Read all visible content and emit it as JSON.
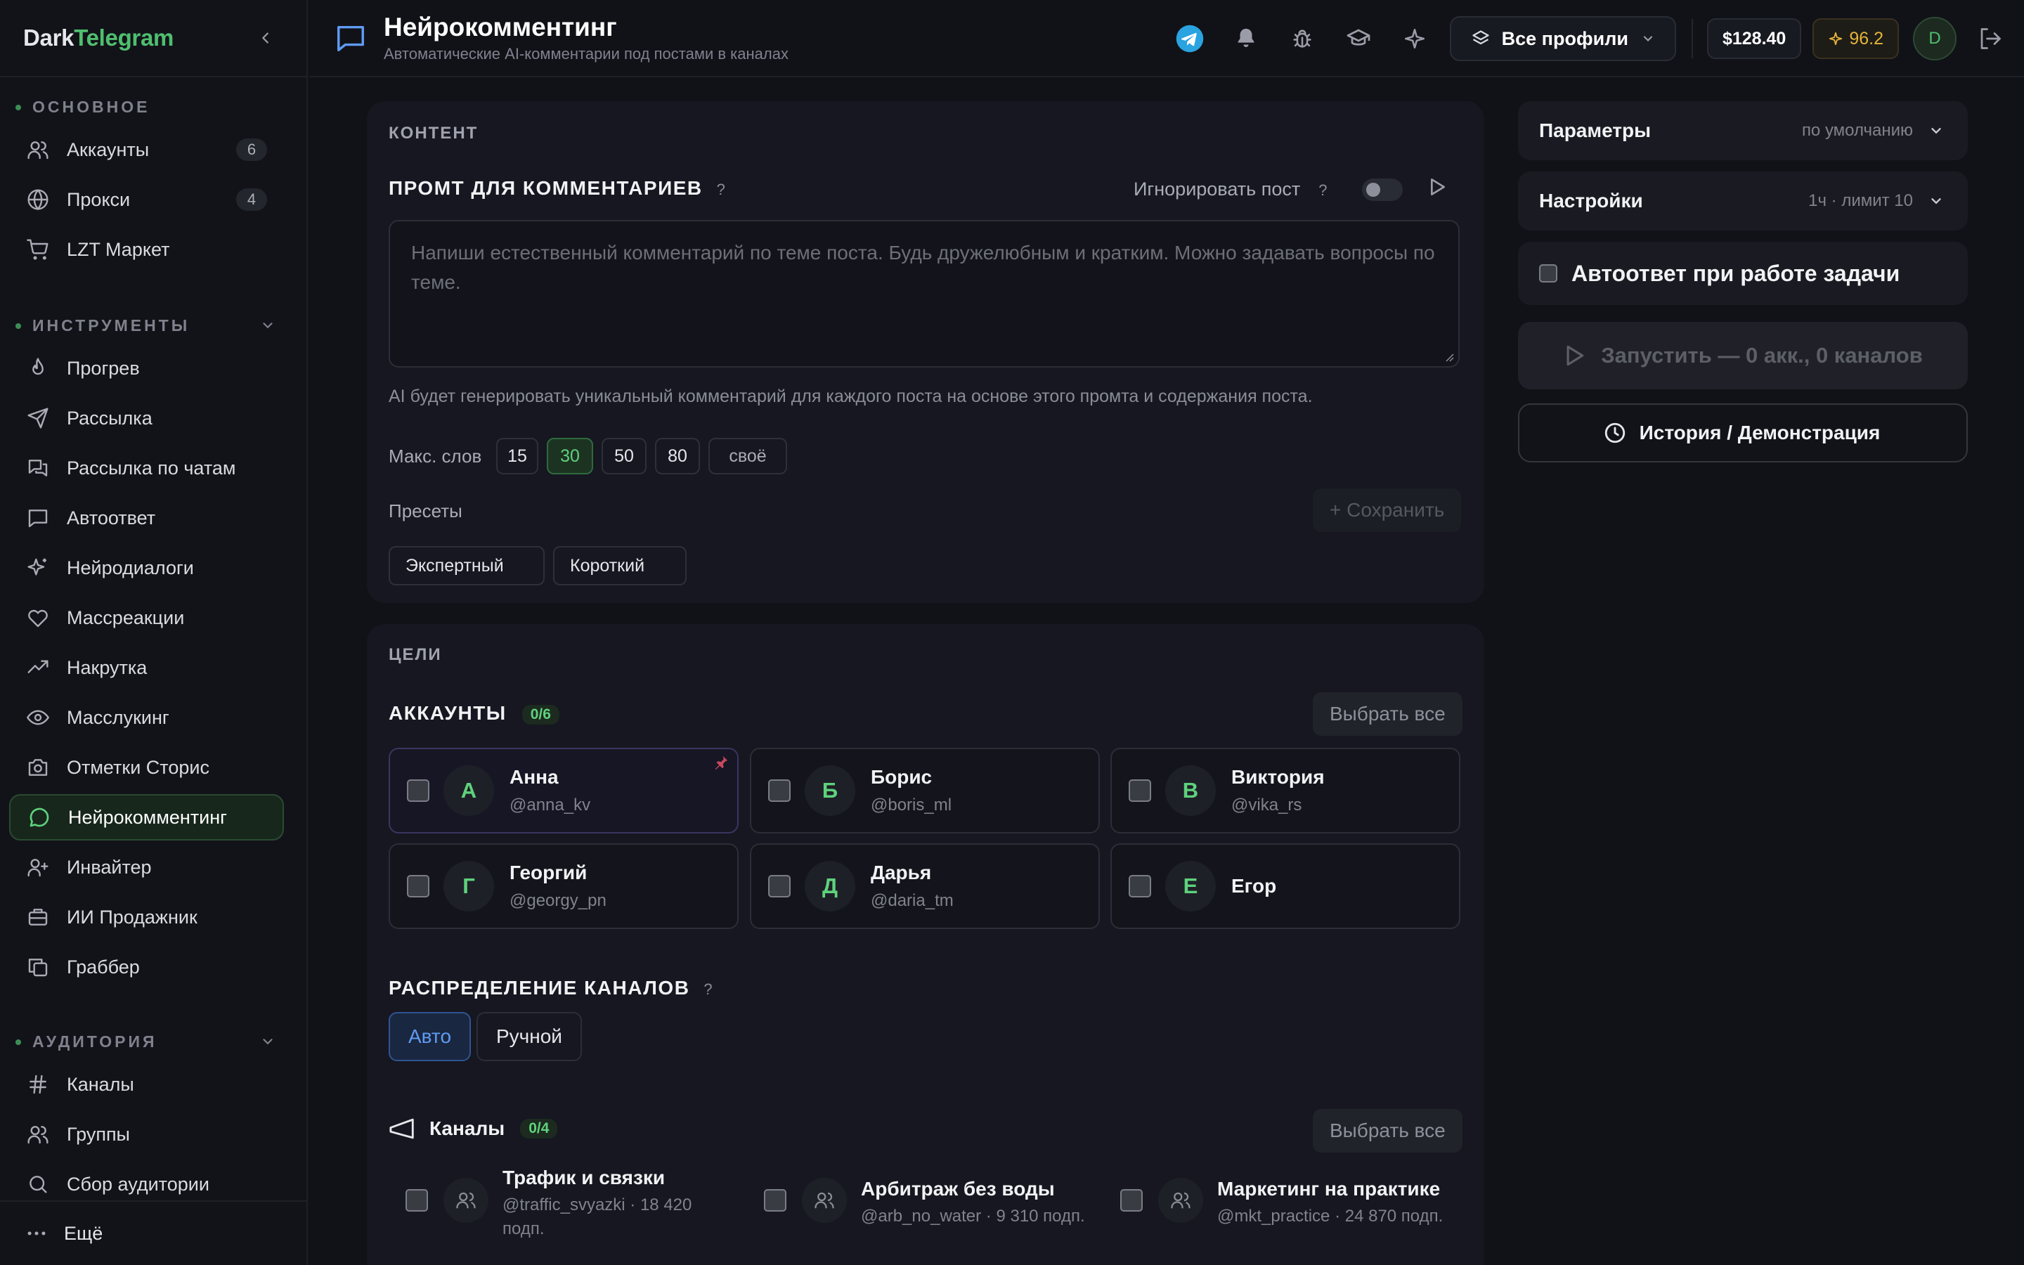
{
  "app": {
    "logo_prefix": "Dark",
    "logo_accent": "Telegram"
  },
  "sidebar": {
    "sections": [
      {
        "title": "ОСНОВНОЕ"
      },
      {
        "title": "ИНСТРУМЕНТЫ"
      },
      {
        "title": "АУДИТОРИЯ"
      }
    ],
    "main_items": [
      {
        "label": "Аккаунты",
        "badge": "6",
        "icon": "users-icon"
      },
      {
        "label": "Прокси",
        "badge": "4",
        "icon": "globe-icon"
      },
      {
        "label": "LZT Маркет",
        "icon": "cart-icon"
      }
    ],
    "tool_items": [
      {
        "label": "Прогрев",
        "icon": "flame-icon"
      },
      {
        "label": "Рассылка",
        "icon": "send-icon"
      },
      {
        "label": "Рассылка по чатам",
        "icon": "chats-icon"
      },
      {
        "label": "Автоответ",
        "icon": "message-square-icon"
      },
      {
        "label": "Нейродиалоги",
        "icon": "sparkles-icon"
      },
      {
        "label": "Массреакции",
        "icon": "heart-icon"
      },
      {
        "label": "Накрутка",
        "icon": "trending-up-icon"
      },
      {
        "label": "Масслукинг",
        "icon": "eye-icon"
      },
      {
        "label": "Отметки Сторис",
        "icon": "camera-icon"
      },
      {
        "label": "Нейрокомментинг",
        "icon": "message-circle-icon",
        "active": true
      },
      {
        "label": "Инвайтер",
        "icon": "user-plus-icon"
      },
      {
        "label": "ИИ Продажник",
        "icon": "briefcase-icon"
      },
      {
        "label": "Граббер",
        "icon": "copy-icon"
      }
    ],
    "audience_items": [
      {
        "label": "Каналы",
        "icon": "hash-icon"
      },
      {
        "label": "Группы",
        "icon": "users-icon"
      },
      {
        "label": "Сбор аудитории",
        "icon": "search-icon"
      }
    ],
    "more_label": "Ещё"
  },
  "header": {
    "title": "Нейрокомментинг",
    "subtitle": "Автоматические AI-комментарии под постами в каналах",
    "profile_select": "Все профили",
    "balance": "$128.40",
    "points": "96.2",
    "avatar_letter": "D"
  },
  "content_card": {
    "label": "КОНТЕНТ",
    "prompt_title": "ПРОМТ ДЛЯ КОММЕНТАРИЕВ",
    "help": "?",
    "ignore_post_label": "Игнорировать пост",
    "ignore_post_on": false,
    "prompt_placeholder": "Напиши естественный комментарий по теме поста. Будь дружелюбным и кратким. Можно задавать вопросы по теме.",
    "hint": "AI будет генерировать уникальный комментарий для каждого поста на основе этого промта и содержания поста.",
    "max_words_label": "Макс. слов",
    "max_words_options": [
      "15",
      "30",
      "50",
      "80",
      "своё"
    ],
    "max_words_selected": "30",
    "presets_label": "Пресеты",
    "save_label": "+ Сохранить",
    "presets": [
      "Экспертный",
      "Короткий"
    ]
  },
  "targets_card": {
    "label": "ЦЕЛИ",
    "accounts_title": "АККАУНТЫ",
    "accounts_count": "0/6",
    "select_all": "Выбрать все",
    "accounts": [
      {
        "letter": "А",
        "name": "Анна",
        "username": "@anna_kv",
        "pinned": true
      },
      {
        "letter": "Б",
        "name": "Борис",
        "username": "@boris_ml"
      },
      {
        "letter": "В",
        "name": "Виктория",
        "username": "@vika_rs"
      },
      {
        "letter": "Г",
        "name": "Георгий",
        "username": "@georgy_pn"
      },
      {
        "letter": "Д",
        "name": "Дарья",
        "username": "@daria_tm"
      },
      {
        "letter": "Е",
        "name": "Егор",
        "username": ""
      }
    ],
    "distribution_title": "РАСПРЕДЕЛЕНИЕ КАНАЛОВ",
    "distribution_options": [
      "Авто",
      "Ручной"
    ],
    "distribution_selected": "Авто",
    "channels_title": "Каналы",
    "channels_count": "0/4",
    "channels": [
      {
        "name": "Трафик и связки",
        "meta_line1": "@traffic_svyazki · 18 420",
        "meta_line2": "подп."
      },
      {
        "name": "Арбитраж без воды",
        "meta_line1": "@arb_no_water · 9 310 подп.",
        "meta_line2": ""
      },
      {
        "name": "Маркетинг на практике",
        "meta_line1": "@mkt_practice · 24 870 подп.",
        "meta_line2": ""
      }
    ]
  },
  "right_panel": {
    "params_title": "Параметры",
    "params_value": "по умолчанию",
    "settings_title": "Настройки",
    "settings_value": "1ч · лимит 10",
    "autoreply_label": "Автоответ при работе задачи",
    "run_label": "Запустить — 0 акк., 0 каналов",
    "history_label": "История / Демонстрация"
  },
  "colors": {
    "accent_green": "#4fbf6f",
    "accent_blue": "#5f9bf2",
    "background": "#111218",
    "card": "#161720"
  }
}
